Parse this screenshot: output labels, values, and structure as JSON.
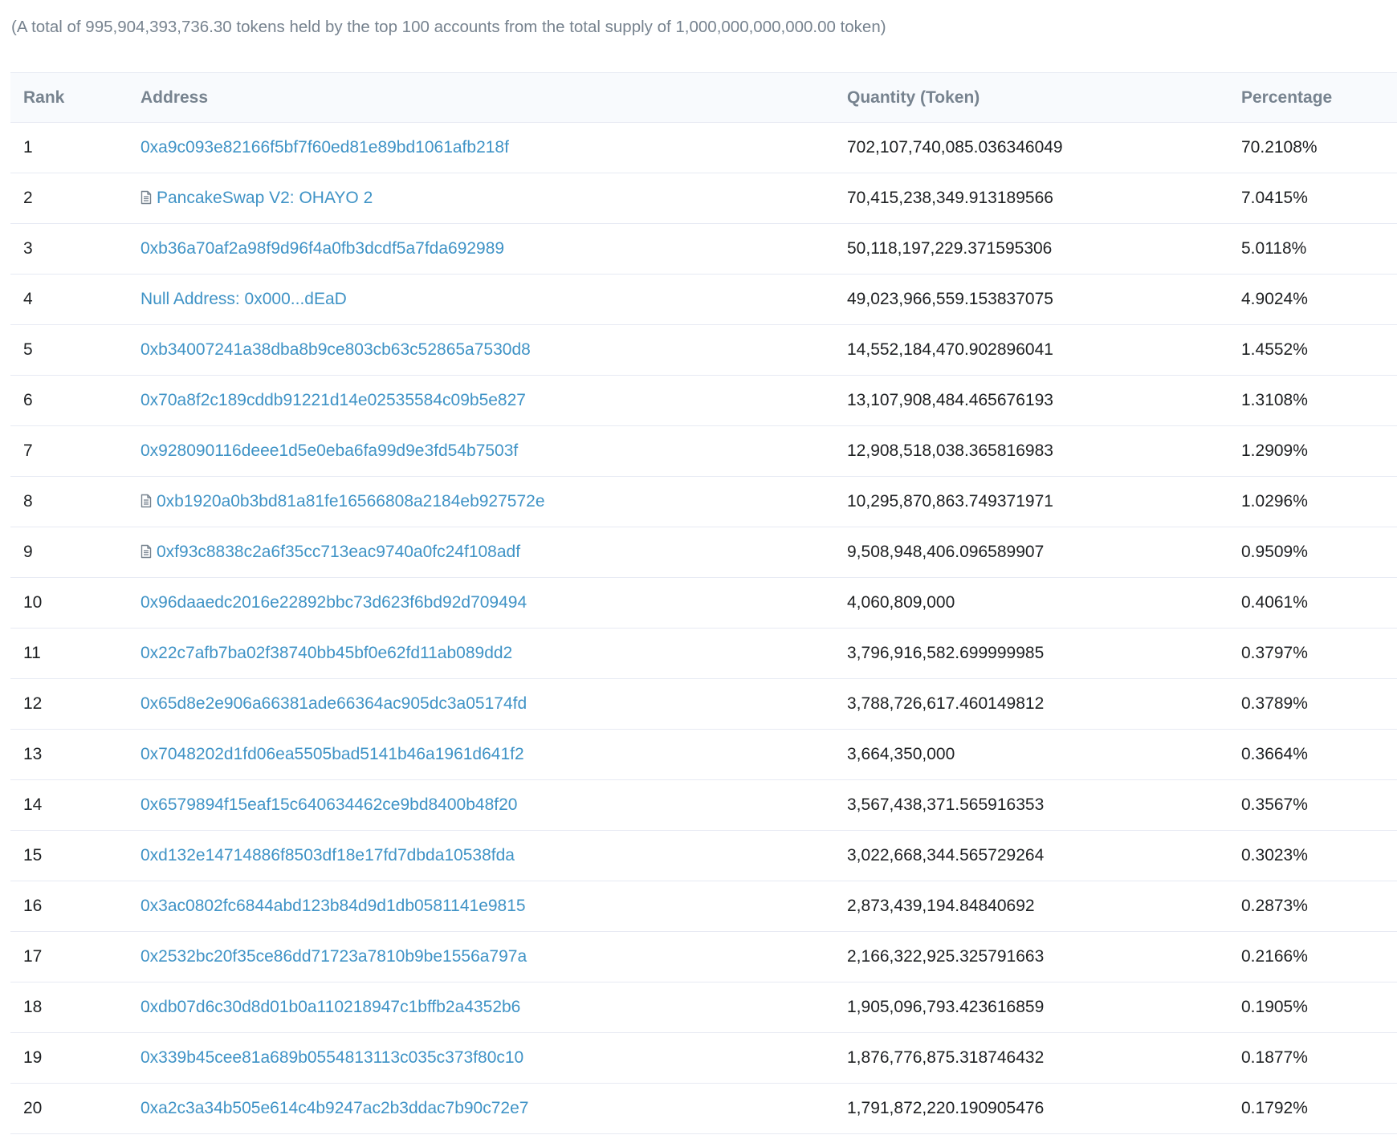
{
  "summary": "(A total of 995,904,393,736.30 tokens held by the top 100 accounts from the total supply of 1,000,000,000,000.00 token)",
  "table": {
    "headers": {
      "rank": "Rank",
      "address": "Address",
      "quantity": "Quantity (Token)",
      "percentage": "Percentage"
    },
    "rows": [
      {
        "rank": "1",
        "address": "0xa9c093e82166f5bf7f60ed81e89bd1061afb218f",
        "contract": false,
        "quantity": "702,107,740,085.036346049",
        "percentage": "70.2108%"
      },
      {
        "rank": "2",
        "address": "PancakeSwap V2: OHAYO 2",
        "contract": true,
        "quantity": "70,415,238,349.913189566",
        "percentage": "7.0415%"
      },
      {
        "rank": "3",
        "address": "0xb36a70af2a98f9d96f4a0fb3dcdf5a7fda692989",
        "contract": false,
        "quantity": "50,118,197,229.371595306",
        "percentage": "5.0118%"
      },
      {
        "rank": "4",
        "address": "Null Address: 0x000...dEaD",
        "contract": false,
        "quantity": "49,023,966,559.153837075",
        "percentage": "4.9024%"
      },
      {
        "rank": "5",
        "address": "0xb34007241a38dba8b9ce803cb63c52865a7530d8",
        "contract": false,
        "quantity": "14,552,184,470.902896041",
        "percentage": "1.4552%"
      },
      {
        "rank": "6",
        "address": "0x70a8f2c189cddb91221d14e02535584c09b5e827",
        "contract": false,
        "quantity": "13,107,908,484.465676193",
        "percentage": "1.3108%"
      },
      {
        "rank": "7",
        "address": "0x928090116deee1d5e0eba6fa99d9e3fd54b7503f",
        "contract": false,
        "quantity": "12,908,518,038.365816983",
        "percentage": "1.2909%"
      },
      {
        "rank": "8",
        "address": "0xb1920a0b3bd81a81fe16566808a2184eb927572e",
        "contract": true,
        "quantity": "10,295,870,863.749371971",
        "percentage": "1.0296%"
      },
      {
        "rank": "9",
        "address": "0xf93c8838c2a6f35cc713eac9740a0fc24f108adf",
        "contract": true,
        "quantity": "9,508,948,406.096589907",
        "percentage": "0.9509%"
      },
      {
        "rank": "10",
        "address": "0x96daaedc2016e22892bbc73d623f6bd92d709494",
        "contract": false,
        "quantity": "4,060,809,000",
        "percentage": "0.4061%"
      },
      {
        "rank": "11",
        "address": "0x22c7afb7ba02f38740bb45bf0e62fd11ab089dd2",
        "contract": false,
        "quantity": "3,796,916,582.699999985",
        "percentage": "0.3797%"
      },
      {
        "rank": "12",
        "address": "0x65d8e2e906a66381ade66364ac905dc3a05174fd",
        "contract": false,
        "quantity": "3,788,726,617.460149812",
        "percentage": "0.3789%"
      },
      {
        "rank": "13",
        "address": "0x7048202d1fd06ea5505bad5141b46a1961d641f2",
        "contract": false,
        "quantity": "3,664,350,000",
        "percentage": "0.3664%"
      },
      {
        "rank": "14",
        "address": "0x6579894f15eaf15c640634462ce9bd8400b48f20",
        "contract": false,
        "quantity": "3,567,438,371.565916353",
        "percentage": "0.3567%"
      },
      {
        "rank": "15",
        "address": "0xd132e14714886f8503df18e17fd7dbda10538fda",
        "contract": false,
        "quantity": "3,022,668,344.565729264",
        "percentage": "0.3023%"
      },
      {
        "rank": "16",
        "address": "0x3ac0802fc6844abd123b84d9d1db0581141e9815",
        "contract": false,
        "quantity": "2,873,439,194.84840692",
        "percentage": "0.2873%"
      },
      {
        "rank": "17",
        "address": "0x2532bc20f35ce86dd71723a7810b9be1556a797a",
        "contract": false,
        "quantity": "2,166,322,925.325791663",
        "percentage": "0.2166%"
      },
      {
        "rank": "18",
        "address": "0xdb07d6c30d8d01b0a110218947c1bffb2a4352b6",
        "contract": false,
        "quantity": "1,905,096,793.423616859",
        "percentage": "0.1905%"
      },
      {
        "rank": "19",
        "address": "0x339b45cee81a689b0554813113c035c373f80c10",
        "contract": false,
        "quantity": "1,876,776,875.318746432",
        "percentage": "0.1877%"
      },
      {
        "rank": "20",
        "address": "0xa2c3a34b505e614c4b9247ac2b3ddac7b90c72e7",
        "contract": false,
        "quantity": "1,791,872,220.190905476",
        "percentage": "0.1792%"
      }
    ]
  },
  "colors": {
    "link": "#3f93c6",
    "muted_text": "#77838f",
    "header_bg": "#f8fafd",
    "border": "#e7eaf3"
  },
  "icons": {
    "contract": "file-document-icon"
  }
}
